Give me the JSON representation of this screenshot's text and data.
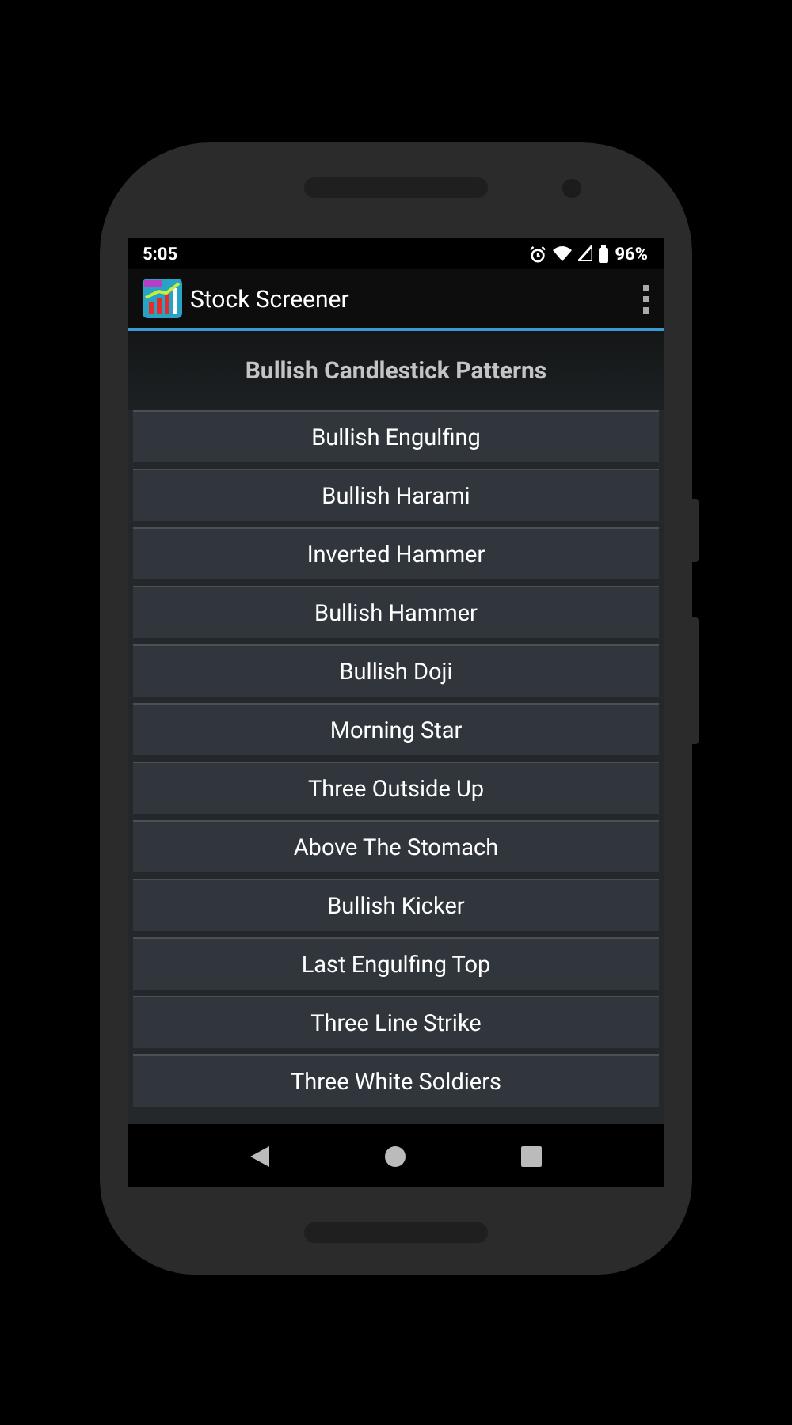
{
  "status_bar": {
    "time": "5:05",
    "battery": "96%"
  },
  "app_bar": {
    "title": "Stock Screener"
  },
  "heading": "Bullish Candlestick Patterns",
  "patterns": [
    "Bullish Engulfing",
    "Bullish Harami",
    "Inverted Hammer",
    "Bullish Hammer",
    "Bullish Doji",
    "Morning Star",
    "Three Outside Up",
    "Above The Stomach",
    "Bullish Kicker",
    "Last Engulfing Top",
    "Three Line Strike",
    "Three White Soldiers"
  ]
}
